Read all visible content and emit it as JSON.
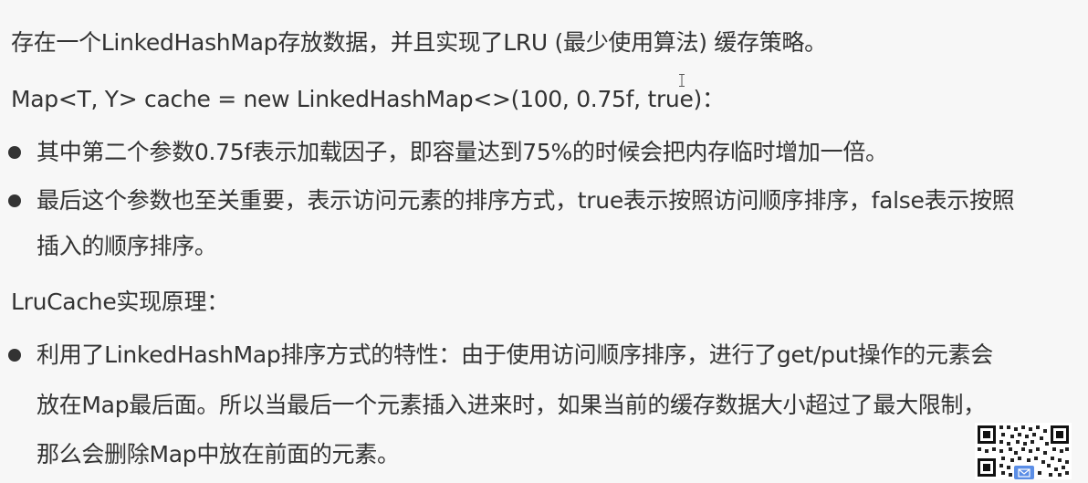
{
  "lines": {
    "intro": "存在一个LinkedHashMap存放数据，并且实现了LRU (最少使用算法) 缓存策略。",
    "code": "Map<T, Y> cache = new LinkedHashMap<>(100, 0.75f, true)：",
    "bullet1": "其中第二个参数0.75f表示加载因子，即容量达到75%的时候会把内存临时增加一倍。",
    "bullet2_a": "最后这个参数也至关重要，表示访问元素的排序方式，true表示按照访问顺序排序，false表示按照",
    "bullet2_b": "插入的顺序排序。",
    "heading": "LruCache实现原理：",
    "bullet3_a": "利用了LinkedHashMap排序方式的特性：由于使用访问顺序排序，进行了get/put操作的元素会",
    "bullet3_b": "放在Map最后面。所以当最后一个元素插入进来时，如果当前的缓存数据大小超过了最大限制，",
    "bullet3_c": "那么会删除Map中放在前面的元素。"
  },
  "icons": {
    "cursor": "text-cursor-icon",
    "qr": "qr-code-icon",
    "mail": "mail-icon"
  },
  "colors": {
    "text": "#333333",
    "background": "#f7f7f7",
    "mail_icon": "#5b8ee6"
  }
}
